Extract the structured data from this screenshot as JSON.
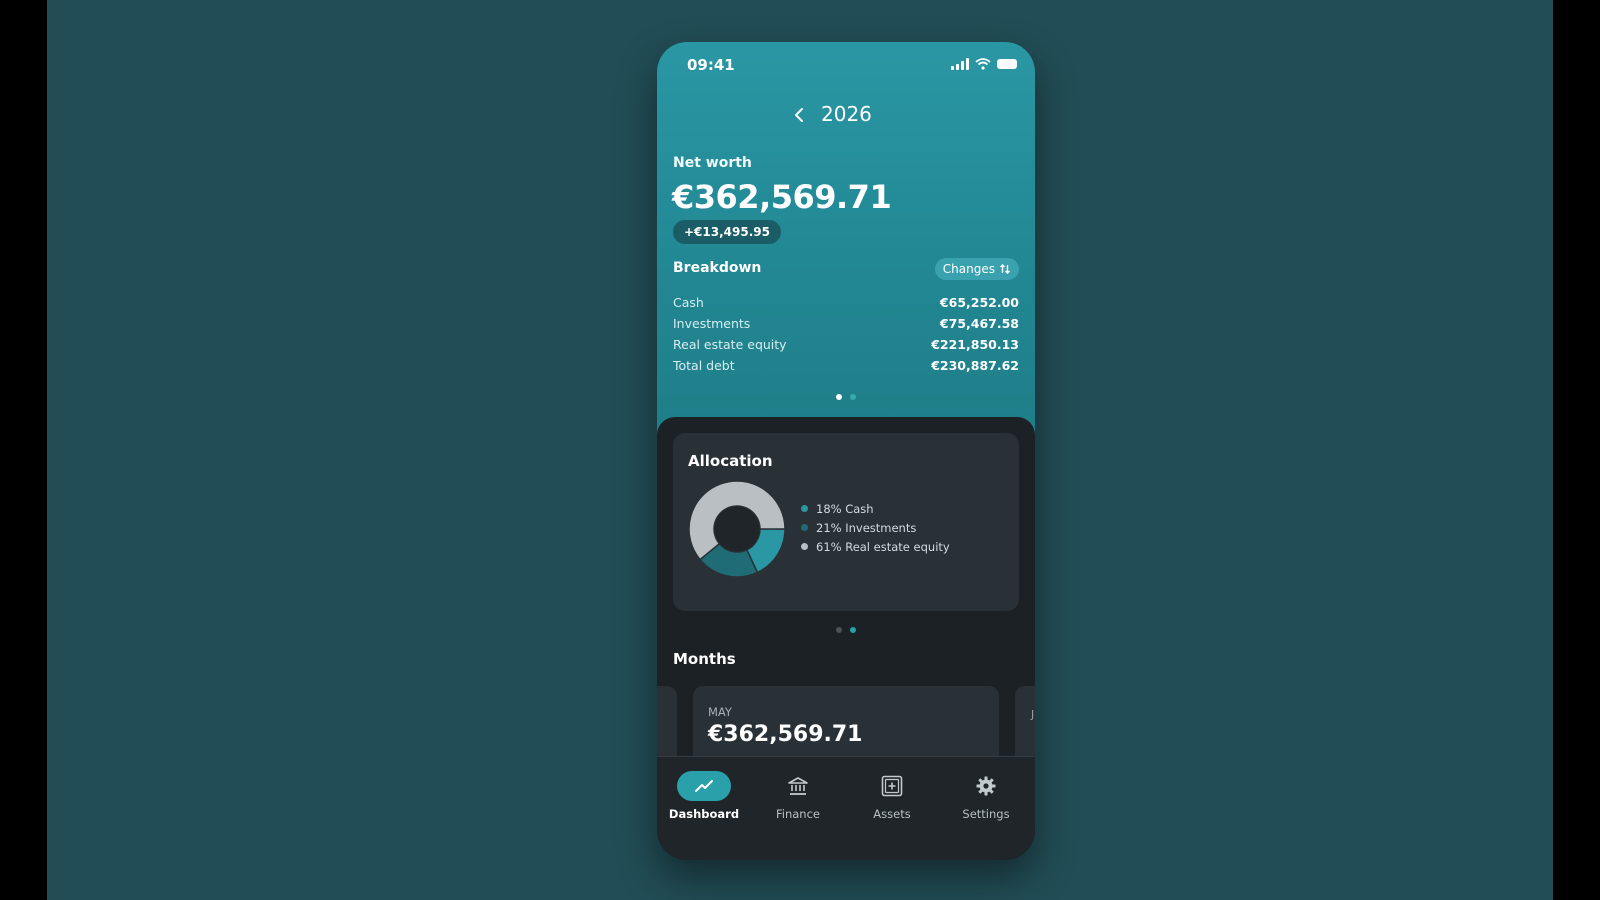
{
  "status": {
    "time": "09:41"
  },
  "header": {
    "year": "2026"
  },
  "net_worth": {
    "label": "Net worth",
    "value": "€362,569.71",
    "change": "+€13,495.95"
  },
  "breakdown": {
    "title": "Breakdown",
    "changes_label": "Changes",
    "rows": [
      {
        "label": "Cash",
        "value": "€65,252.00"
      },
      {
        "label": "Investments",
        "value": "€75,467.58"
      },
      {
        "label": "Real estate equity",
        "value": "€221,850.13"
      },
      {
        "label": "Total debt",
        "value": "€230,887.62"
      }
    ]
  },
  "allocation": {
    "title": "Allocation",
    "segments": [
      {
        "label": "18% Cash",
        "percent": 18,
        "color": "#2a98a4"
      },
      {
        "label": "21% Investments",
        "percent": 21,
        "color": "#1f6b76"
      },
      {
        "label": "61% Real estate equity",
        "percent": 61,
        "color": "#b9bfc2"
      }
    ]
  },
  "months": {
    "title": "Months",
    "card": {
      "label": "MAY",
      "value": "€362,569.71"
    },
    "next_peek": "J"
  },
  "tabs": [
    {
      "label": "Dashboard",
      "icon": "trend-icon",
      "active": true
    },
    {
      "label": "Finance",
      "icon": "bank-icon",
      "active": false
    },
    {
      "label": "Assets",
      "icon": "assets-icon",
      "active": false
    },
    {
      "label": "Settings",
      "icon": "gear-icon",
      "active": false
    }
  ],
  "colors": {
    "background": "#224d56",
    "hero": "#2a97a4",
    "card": "#2a3136",
    "accent": "#2aa0ab"
  }
}
